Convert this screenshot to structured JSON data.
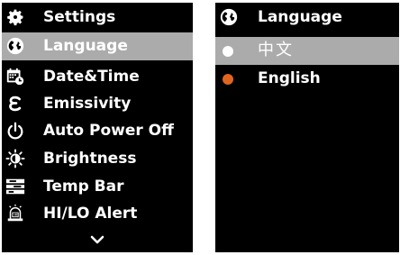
{
  "settings": {
    "title": "Settings",
    "items": [
      {
        "label": "Language",
        "icon": "globe-icon",
        "selected": true
      },
      {
        "label": "Date&Time",
        "icon": "calendar-clock-icon",
        "selected": false
      },
      {
        "label": "Emissivity",
        "icon": "epsilon-icon",
        "selected": false
      },
      {
        "label": "Auto Power Off",
        "icon": "power-icon",
        "selected": false
      },
      {
        "label": "Brightness",
        "icon": "brightness-icon",
        "selected": false
      },
      {
        "label": "Temp Bar",
        "icon": "temp-bar-icon",
        "selected": false
      },
      {
        "label": "HI/LO Alert",
        "icon": "alert-bell-icon",
        "selected": false
      }
    ],
    "more_icon": "chevron-down-icon"
  },
  "language": {
    "title": "Language",
    "options": [
      {
        "label": "中文",
        "marker_color": "#ffffff",
        "highlighted": true
      },
      {
        "label": "English",
        "marker_color": "#e0661f",
        "highlighted": false
      }
    ]
  },
  "colors": {
    "background": "#000000",
    "highlight": "#ababab",
    "accent": "#e0661f"
  }
}
